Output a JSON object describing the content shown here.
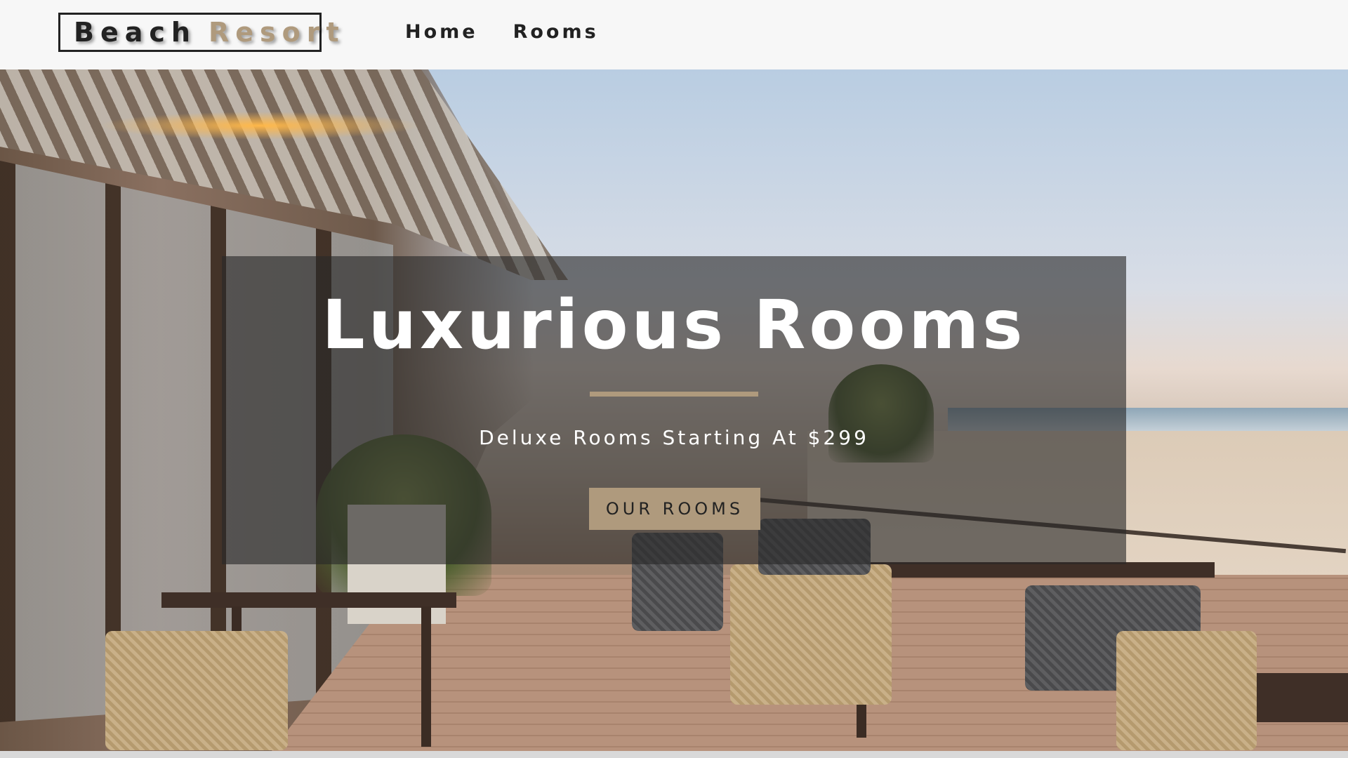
{
  "brand": {
    "word1": "Beach",
    "word2": "Resort",
    "accent_color": "#af9a7d"
  },
  "nav": {
    "items": [
      {
        "label": "Home"
      },
      {
        "label": "Rooms"
      }
    ]
  },
  "hero": {
    "title": "Luxurious Rooms",
    "subtitle": "Deluxe Rooms Starting At $299",
    "button_label": "OUR ROOMS"
  }
}
